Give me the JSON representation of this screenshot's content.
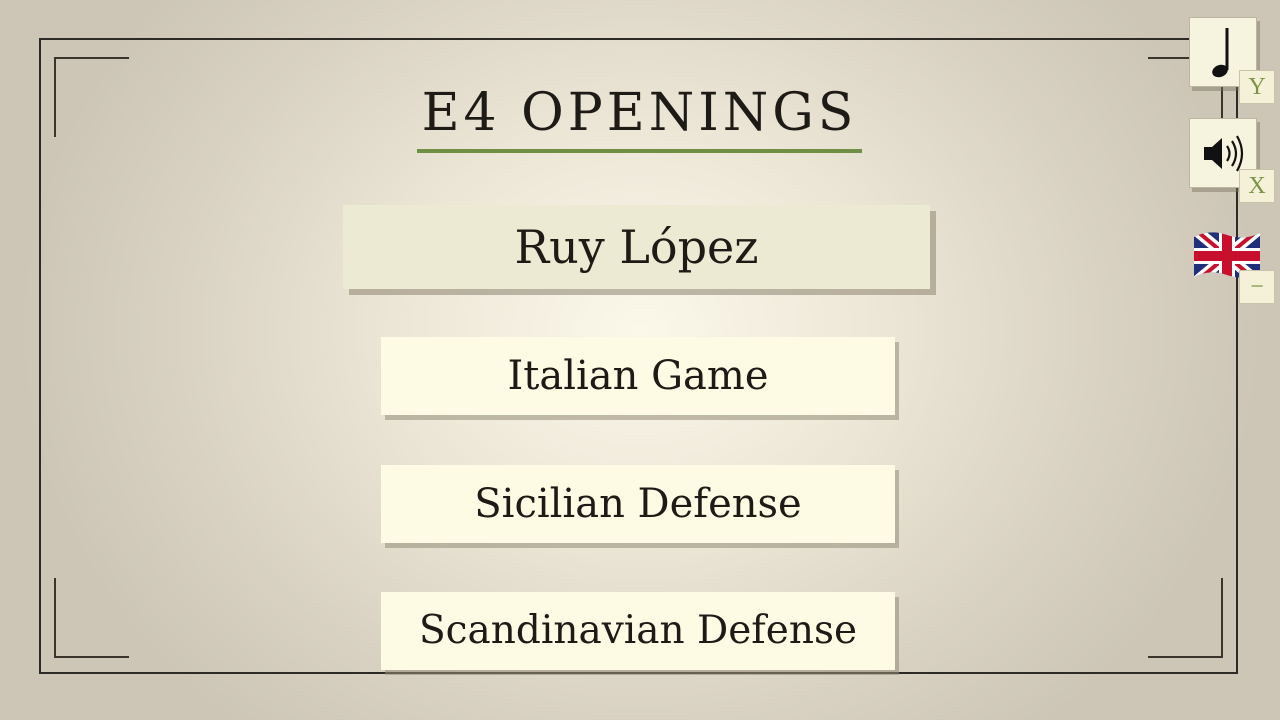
{
  "title": "E4 OPENINGS",
  "menu": {
    "items": [
      {
        "label": "Ruy López",
        "selected": true
      },
      {
        "label": "Italian Game",
        "selected": false
      },
      {
        "label": "Sicilian Defense",
        "selected": false
      },
      {
        "label": "Scandinavian Defense",
        "selected": false
      }
    ]
  },
  "side_controls": {
    "music": {
      "icon": "music-note-icon",
      "key": "Y"
    },
    "sound": {
      "icon": "speaker-icon",
      "key": "X"
    },
    "language": {
      "icon": "uk-flag-icon",
      "key": "−"
    }
  },
  "colors": {
    "accent_green": "#6f8f45",
    "button_bg": "#fdfbe4",
    "selected_bg": "#ecead2",
    "frame": "#2e2a25"
  }
}
